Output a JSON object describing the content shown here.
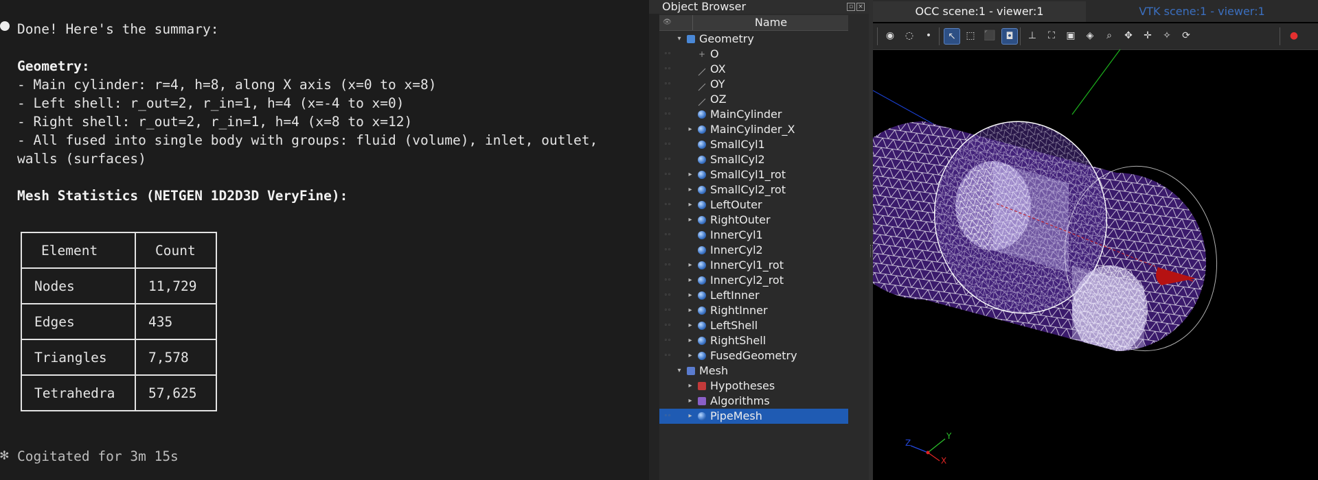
{
  "terminal": {
    "line_done": "Done! Here's the summary:",
    "geometry_heading": "Geometry:",
    "geometry_lines": [
      "- Main cylinder: r=4, h=8, along X axis (x=0 to x=8)",
      "- Left shell: r_out=2, r_in=1, h=4 (x=-4 to x=0)",
      "- Right shell: r_out=2, r_in=1, h=4 (x=8 to x=12)",
      "- All fused into single body with groups: fluid (volume), inlet, outlet,",
      "walls (surfaces)"
    ],
    "mesh_heading": "Mesh Statistics (NETGEN 1D2D3D VeryFine):",
    "table": {
      "headers": [
        "Element",
        "Count"
      ],
      "rows": [
        [
          "Nodes",
          "11,729"
        ],
        [
          "Edges",
          "435"
        ],
        [
          "Triangles",
          "7,578"
        ],
        [
          "Tetrahedra",
          "57,625"
        ]
      ]
    },
    "status_glyph": "✻",
    "status": "Cogitated for 3m 15s"
  },
  "object_browser": {
    "title": "Object Browser",
    "column_header": "Name",
    "items": [
      {
        "label": "Geometry",
        "icon": "geometry-icon",
        "level": 0,
        "expand": "open"
      },
      {
        "label": "O",
        "icon": "point-icon",
        "level": 1,
        "expand": ""
      },
      {
        "label": "OX",
        "icon": "line-icon",
        "level": 1,
        "expand": ""
      },
      {
        "label": "OY",
        "icon": "line-icon",
        "level": 1,
        "expand": ""
      },
      {
        "label": "OZ",
        "icon": "line-icon",
        "level": 1,
        "expand": ""
      },
      {
        "label": "MainCylinder",
        "icon": "solid-icon",
        "level": 1,
        "expand": ""
      },
      {
        "label": "MainCylinder_X",
        "icon": "solid-icon",
        "level": 1,
        "expand": "closed"
      },
      {
        "label": "SmallCyl1",
        "icon": "solid-icon",
        "level": 1,
        "expand": ""
      },
      {
        "label": "SmallCyl2",
        "icon": "solid-icon",
        "level": 1,
        "expand": ""
      },
      {
        "label": "SmallCyl1_rot",
        "icon": "solid-icon",
        "level": 1,
        "expand": "closed"
      },
      {
        "label": "SmallCyl2_rot",
        "icon": "solid-icon",
        "level": 1,
        "expand": "closed"
      },
      {
        "label": "LeftOuter",
        "icon": "solid-icon",
        "level": 1,
        "expand": "closed"
      },
      {
        "label": "RightOuter",
        "icon": "solid-icon",
        "level": 1,
        "expand": "closed"
      },
      {
        "label": "InnerCyl1",
        "icon": "solid-icon",
        "level": 1,
        "expand": ""
      },
      {
        "label": "InnerCyl2",
        "icon": "solid-icon",
        "level": 1,
        "expand": ""
      },
      {
        "label": "InnerCyl1_rot",
        "icon": "solid-icon",
        "level": 1,
        "expand": "closed"
      },
      {
        "label": "InnerCyl2_rot",
        "icon": "solid-icon",
        "level": 1,
        "expand": "closed"
      },
      {
        "label": "LeftInner",
        "icon": "solid-icon",
        "level": 1,
        "expand": "closed"
      },
      {
        "label": "RightInner",
        "icon": "solid-icon",
        "level": 1,
        "expand": "closed"
      },
      {
        "label": "LeftShell",
        "icon": "solid-icon",
        "level": 1,
        "expand": "closed"
      },
      {
        "label": "RightShell",
        "icon": "solid-icon",
        "level": 1,
        "expand": "closed"
      },
      {
        "label": "FusedGeometry",
        "icon": "solid-icon",
        "level": 1,
        "expand": "closed"
      },
      {
        "label": "Mesh",
        "icon": "mesh-icon",
        "level": 0,
        "expand": "open"
      },
      {
        "label": "Hypotheses",
        "icon": "hypotheses-icon",
        "level": 1,
        "expand": "closed"
      },
      {
        "label": "Algorithms",
        "icon": "algorithms-icon",
        "level": 1,
        "expand": "closed"
      },
      {
        "label": "PipeMesh",
        "icon": "mesh-object-icon",
        "level": 1,
        "expand": "closed",
        "selected": true
      }
    ]
  },
  "viewer": {
    "tabs": [
      {
        "label": "OCC scene:1 - viewer:1",
        "active": true
      },
      {
        "label": "VTK scene:1 - viewer:1",
        "active": false
      }
    ],
    "axis_labels": {
      "x": "X",
      "y": "Y",
      "z": "Z"
    }
  },
  "colors": {
    "terminal_bg": "#1c1c1c",
    "selection": "#1f5bb3",
    "vtk_tab_text": "#3b6fbf",
    "mesh_fill": "#3a1a6b",
    "mesh_wire": "#ffffff"
  }
}
